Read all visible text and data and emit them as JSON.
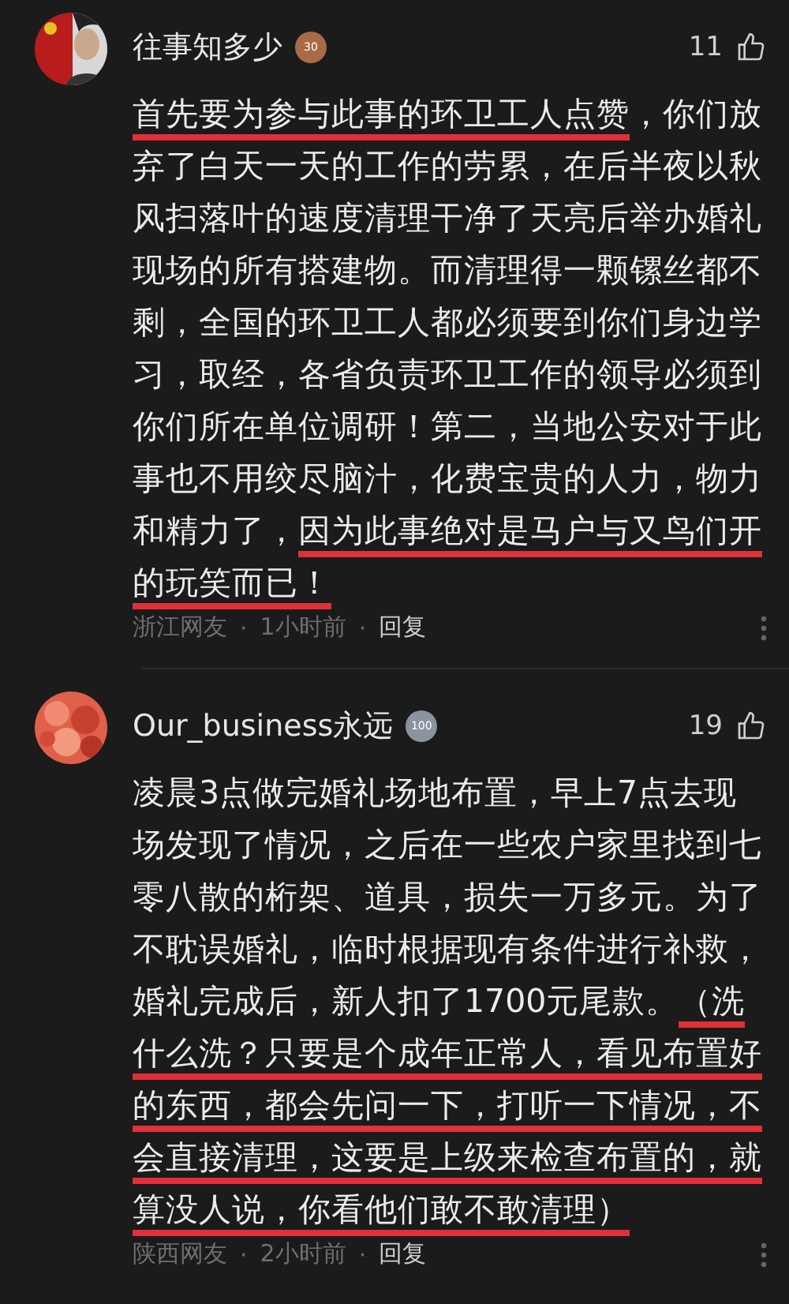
{
  "separator": "·",
  "comments": [
    {
      "user": "往事知多少",
      "badge": {
        "text": "30",
        "color": "#a86b45"
      },
      "likes": "11",
      "avatar": {
        "kind": "picture"
      },
      "body": [
        {
          "text": "首先要为参与此事的环卫工人点赞",
          "marked": true
        },
        {
          "text": "，你们放弃了白天一天的工作的劳累，在后半夜以秋风扫落叶的速度清理干净了天亮后举办婚礼现场的所有搭建物。而清理得一颗镙丝都不剩，全国的环卫工人都必须要到你们身边学习，取经，各省负责环卫工作的领导必须到你们所在单位调研！第二，当地公安对于此事也不用绞尽脑汁，化费宝贵的人力，物力和精力了，",
          "marked": false
        },
        {
          "text": "因为此事绝对是马户与又鸟们开的玩笑而已！",
          "marked": true
        }
      ],
      "location": "浙江网友",
      "time": "1小时前",
      "reply": "回复"
    },
    {
      "user": "Our_business永远",
      "badge": {
        "text": "100",
        "color": "#8a949e"
      },
      "likes": "19",
      "avatar": {
        "kind": "picture"
      },
      "body": [
        {
          "text": "凌晨3点做完婚礼场地布置，早上7点去现场发现了情况，之后在一些农户家里找到七零八散的桁架、道具，损失一万多元。为了不耽误婚礼，临时根据现有条件进行补救，婚礼完成后，新人扣了1700元尾款。",
          "marked": false
        },
        {
          "text": "（洗什么洗？只要是个成年正常人，看见布置好的东西，都会先问一下，打听一下情况，不会直接清理，这要是上级来检查布置的，就算没人说，你看他们敢不敢清理）",
          "marked": true
        }
      ],
      "location": "陕西网友",
      "time": "2小时前",
      "reply": "回复"
    }
  ]
}
